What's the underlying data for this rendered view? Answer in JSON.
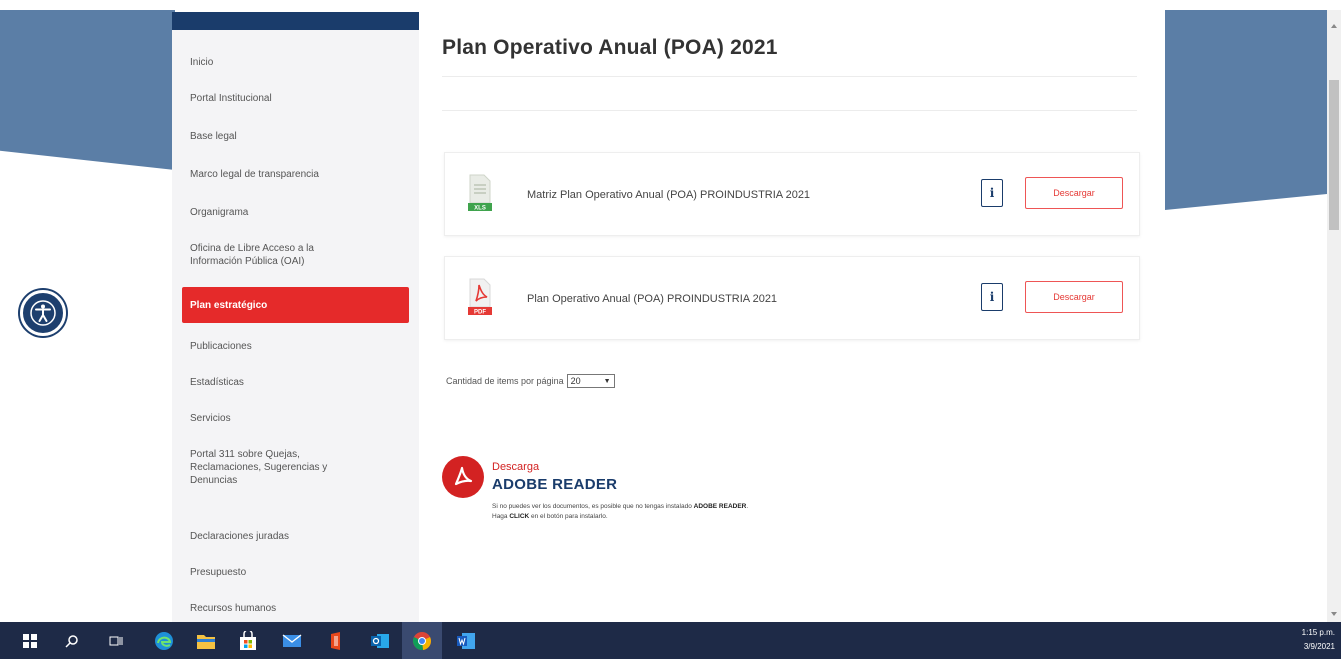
{
  "sidebar": {
    "items": [
      {
        "label": "Inicio"
      },
      {
        "label": "Portal Institucional"
      },
      {
        "label": "Base legal"
      },
      {
        "label": "Marco legal de transparencia"
      },
      {
        "label": "Organigrama"
      },
      {
        "label": "Oficina de Libre Acceso a la Información Pública (OAI)"
      },
      {
        "label": "Plan estratégico"
      },
      {
        "label": "Publicaciones"
      },
      {
        "label": "Estadísticas"
      },
      {
        "label": "Servicios"
      },
      {
        "label": "Portal 311 sobre Quejas, Reclamaciones, Sugerencias y Denuncias"
      },
      {
        "label": "Declaraciones juradas"
      },
      {
        "label": "Presupuesto"
      },
      {
        "label": "Recursos humanos"
      }
    ]
  },
  "main": {
    "title": "Plan Operativo Anual (POA) 2021",
    "documents": [
      {
        "name": "Matriz Plan Operativo Anual (POA) PROINDUSTRIA 2021",
        "type": "XLS",
        "download_label": "Descargar",
        "info_label": "i"
      },
      {
        "name": "Plan Operativo Anual (POA) PROINDUSTRIA 2021",
        "type": "PDF",
        "download_label": "Descargar",
        "info_label": "i"
      }
    ],
    "per_page_label": "Cantidad de items por página",
    "per_page_value": "20"
  },
  "adobe": {
    "download_label": "Descarga",
    "reader_label": "ADOBE READER",
    "note_1": "Si no puedes ver los documentos, es posible que no tengas instalado ",
    "note_bold_1": "ADOBE READER",
    "note_2": "Haga ",
    "note_bold_2": "CLICK",
    "note_3": " en el botón para instalarlo."
  },
  "taskbar": {
    "time": "1:15 p.m.",
    "date": "3/9/2021",
    "apps": [
      "windows-start",
      "search",
      "task-view",
      "edge",
      "file-explorer",
      "store",
      "mail",
      "office",
      "outlook",
      "chrome",
      "word"
    ]
  },
  "colors": {
    "navy": "#1a3c6b",
    "accent_red": "#e52a2a",
    "banner_blue": "#5b7ea6",
    "taskbar": "#1e2a47"
  }
}
